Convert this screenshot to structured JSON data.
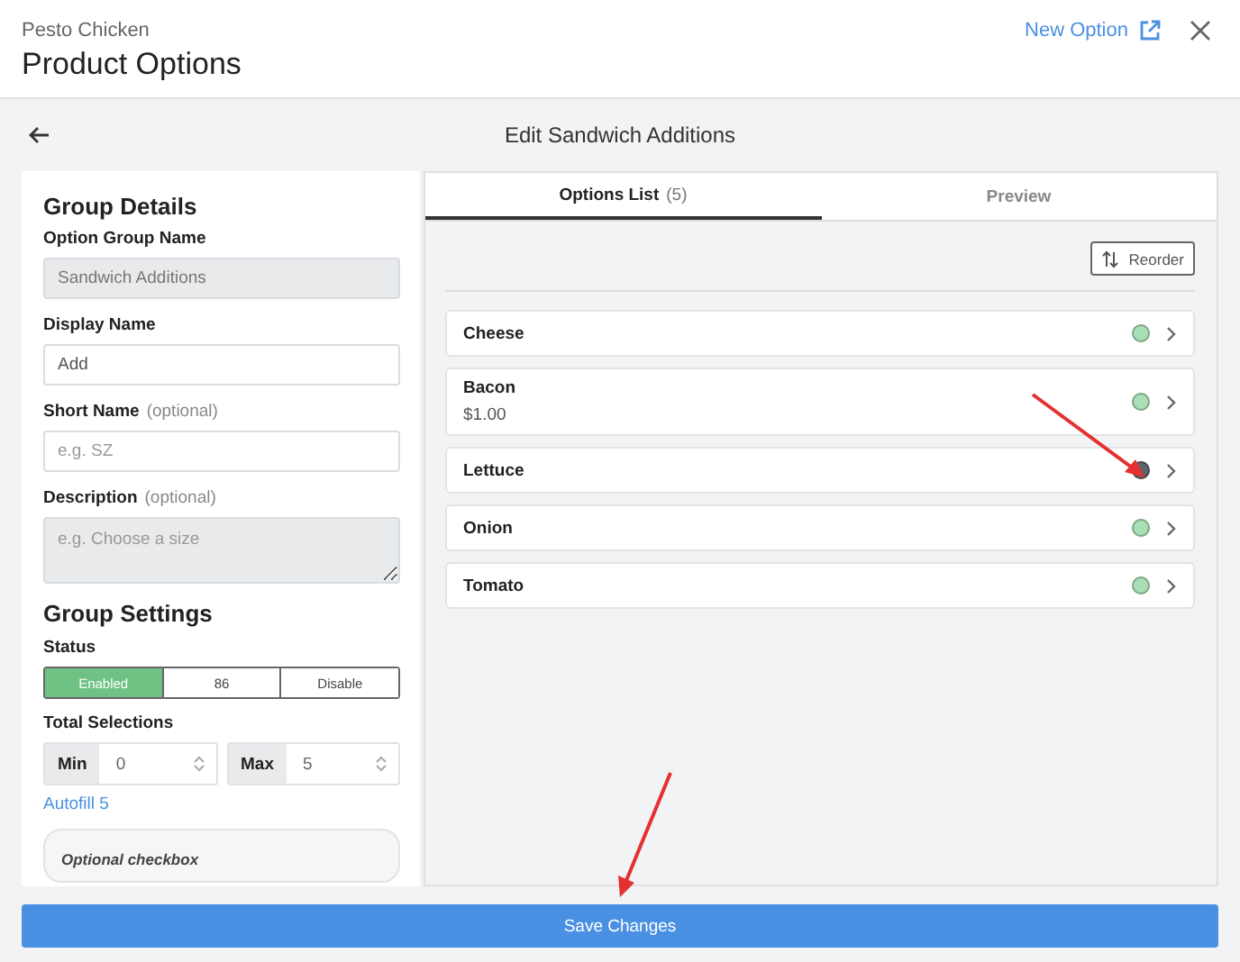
{
  "header": {
    "subtitle": "Pesto Chicken",
    "title": "Product Options",
    "new_option_link": "New Option"
  },
  "subheader": {
    "title": "Edit Sandwich Additions"
  },
  "group_details": {
    "heading": "Group Details",
    "fields": [
      {
        "kind": "input",
        "label": "Option Group Name",
        "value": "Sandwich Additions",
        "disabled": true
      },
      {
        "kind": "input",
        "label": "Display Name",
        "value": "Add",
        "disabled": false
      },
      {
        "kind": "input",
        "label": "Short Name",
        "note": "(optional)",
        "placeholder": "e.g. SZ",
        "disabled": false
      },
      {
        "kind": "textarea",
        "label": "Description",
        "note": "(optional)",
        "placeholder": "e.g. Choose a size",
        "disabled": true
      }
    ]
  },
  "group_settings": {
    "heading": "Group Settings",
    "status_label": "Status",
    "status_options": [
      {
        "label": "Enabled",
        "selected": true
      },
      {
        "label": "86",
        "selected": false
      },
      {
        "label": "Disable",
        "selected": false
      }
    ],
    "total_selections_label": "Total Selections",
    "min": {
      "label": "Min",
      "value": "0"
    },
    "max": {
      "label": "Max",
      "value": "5"
    },
    "autofill_link": "Autofill 5",
    "optional_checkbox_title": "Optional checkbox"
  },
  "tabs": [
    {
      "label": "Options List",
      "count": "(5)",
      "selected": true
    },
    {
      "label": "Preview",
      "selected": false
    }
  ],
  "reorder_button": "Reorder",
  "options": [
    {
      "name": "Cheese",
      "color": "#a8dfb4"
    },
    {
      "name": "Bacon",
      "price": "$1.00",
      "color": "#a8dfb4"
    },
    {
      "name": "Lettuce",
      "color": "#5f6368"
    },
    {
      "name": "Onion",
      "color": "#a8dfb4"
    },
    {
      "name": "Tomato",
      "color": "#a8dfb4"
    }
  ],
  "save_button": "Save Changes"
}
